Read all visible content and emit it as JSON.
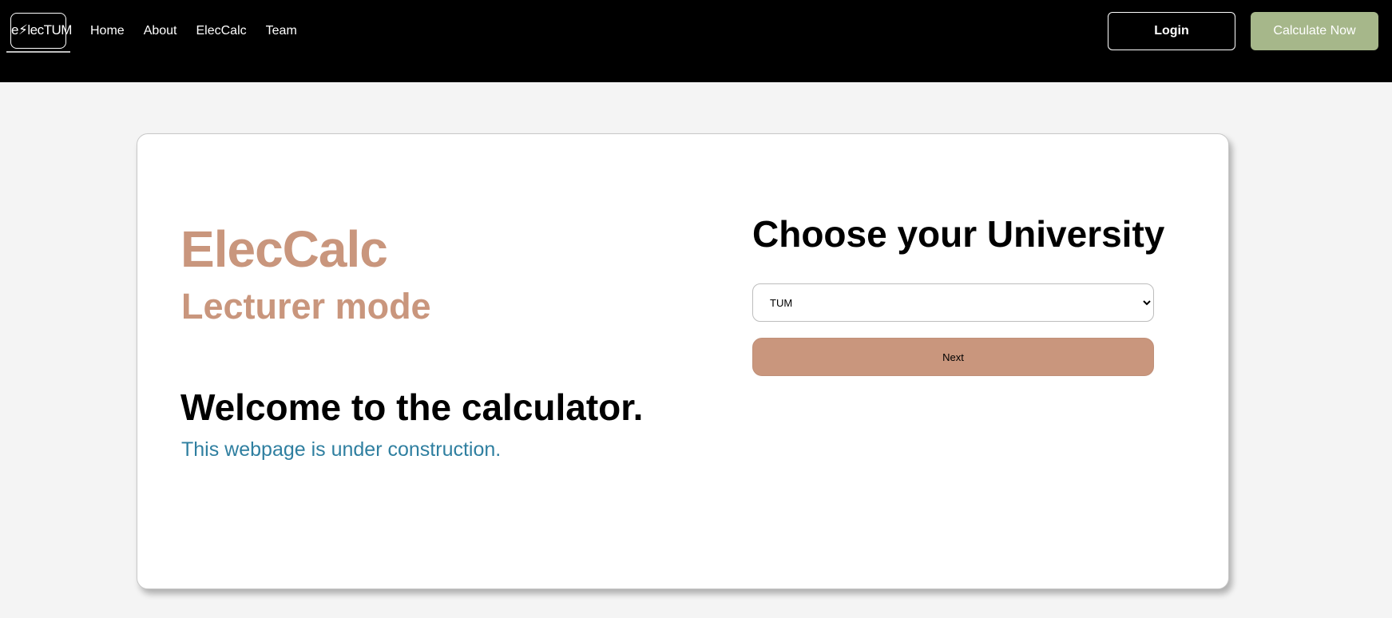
{
  "navbar": {
    "logo_text": "e⚡lecTUM",
    "links": [
      "Home",
      "About",
      "ElecCalc",
      "Team"
    ],
    "login_label": "Login",
    "calculate_label": "Calculate Now"
  },
  "card": {
    "title": "ElecCalc",
    "mode": "Lecturer mode",
    "welcome": "Welcome to the calculator.",
    "notice": "This webpage is under construction.",
    "choose_title": "Choose your University",
    "university_options": [
      "TUM"
    ],
    "selected_university": "TUM",
    "next_label": "Next"
  },
  "colors": {
    "navbar_bg": "#000000",
    "accent_brown": "#c9967d",
    "accent_green": "#a6b78a",
    "notice_blue": "#2f7fa0",
    "page_bg": "#f4f4f4"
  }
}
